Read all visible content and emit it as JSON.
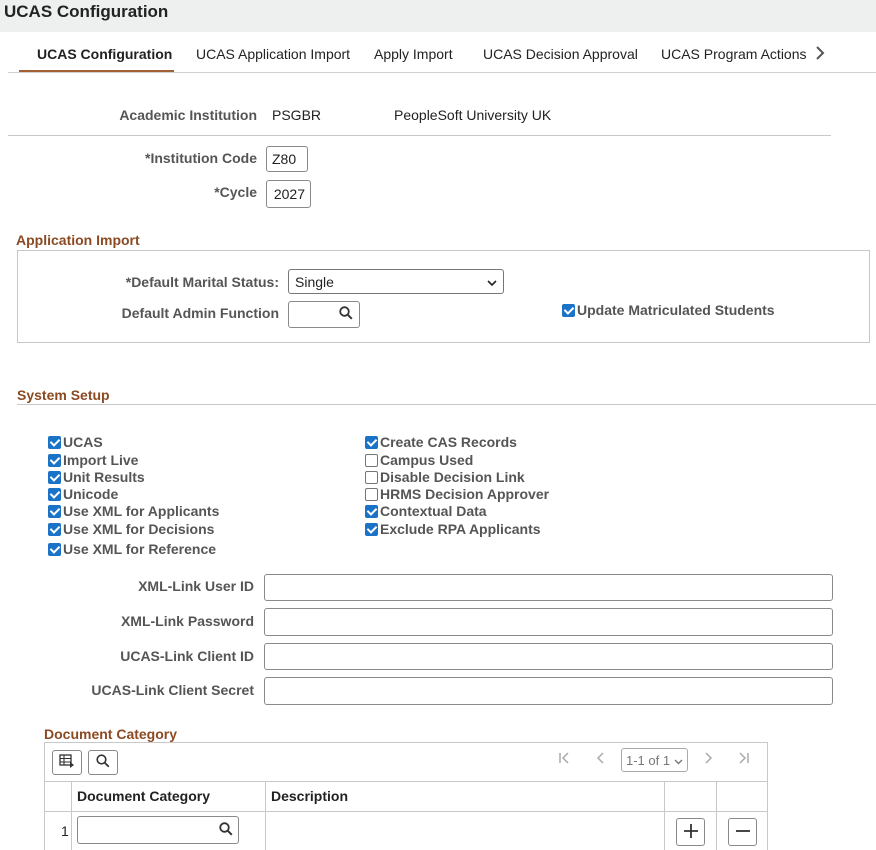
{
  "header": {
    "title": "UCAS Configuration"
  },
  "tabs": [
    {
      "label": "UCAS Configuration"
    },
    {
      "label": "UCAS Application Import"
    },
    {
      "label": "Apply Import"
    },
    {
      "label": "UCAS Decision Approval"
    },
    {
      "label": "UCAS Program Actions"
    }
  ],
  "institution": {
    "label": "Academic Institution",
    "code": "PSGBR",
    "name": "PeopleSoft University UK",
    "inst_code_label": "*Institution Code",
    "inst_code_value": "Z80",
    "cycle_label": "*Cycle",
    "cycle_value": "2027"
  },
  "application_import": {
    "title": "Application Import",
    "marital_label": "*Default Marital Status:",
    "marital_value": "Single",
    "admin_label": "Default Admin Function",
    "admin_value": "",
    "update_matric_label": "Update Matriculated Students",
    "update_matric_checked": true
  },
  "system_setup": {
    "title": "System Setup",
    "left": [
      {
        "label": "UCAS",
        "checked": true
      },
      {
        "label": "Import Live",
        "checked": true
      },
      {
        "label": "Unit Results",
        "checked": true
      },
      {
        "label": "Unicode",
        "checked": true
      },
      {
        "label": "Use XML for Applicants",
        "checked": true
      },
      {
        "label": "Use XML for Decisions",
        "checked": true
      },
      {
        "label": "Use XML for Reference",
        "checked": true
      }
    ],
    "right": [
      {
        "label": "Create CAS Records",
        "checked": true
      },
      {
        "label": "Campus Used",
        "checked": false
      },
      {
        "label": "Disable Decision Link",
        "checked": false
      },
      {
        "label": "HRMS Decision Approver",
        "checked": false
      },
      {
        "label": "Contextual Data",
        "checked": true
      },
      {
        "label": "Exclude RPA Applicants",
        "checked": true
      }
    ],
    "fields": [
      {
        "label": "XML-Link User ID",
        "value": ""
      },
      {
        "label": "XML-Link Password",
        "value": ""
      },
      {
        "label": "UCAS-Link Client ID",
        "value": ""
      },
      {
        "label": "UCAS-Link Client Secret",
        "value": ""
      }
    ]
  },
  "doc_category": {
    "title": "Document Category",
    "pager": "1-1 of 1",
    "columns": [
      "Document Category",
      "Description"
    ],
    "rows": [
      {
        "num": "1",
        "category": "",
        "description": ""
      }
    ]
  },
  "colors": {
    "accent": "#a26034",
    "section": "#8b4a22",
    "check": "#1a73c7"
  }
}
